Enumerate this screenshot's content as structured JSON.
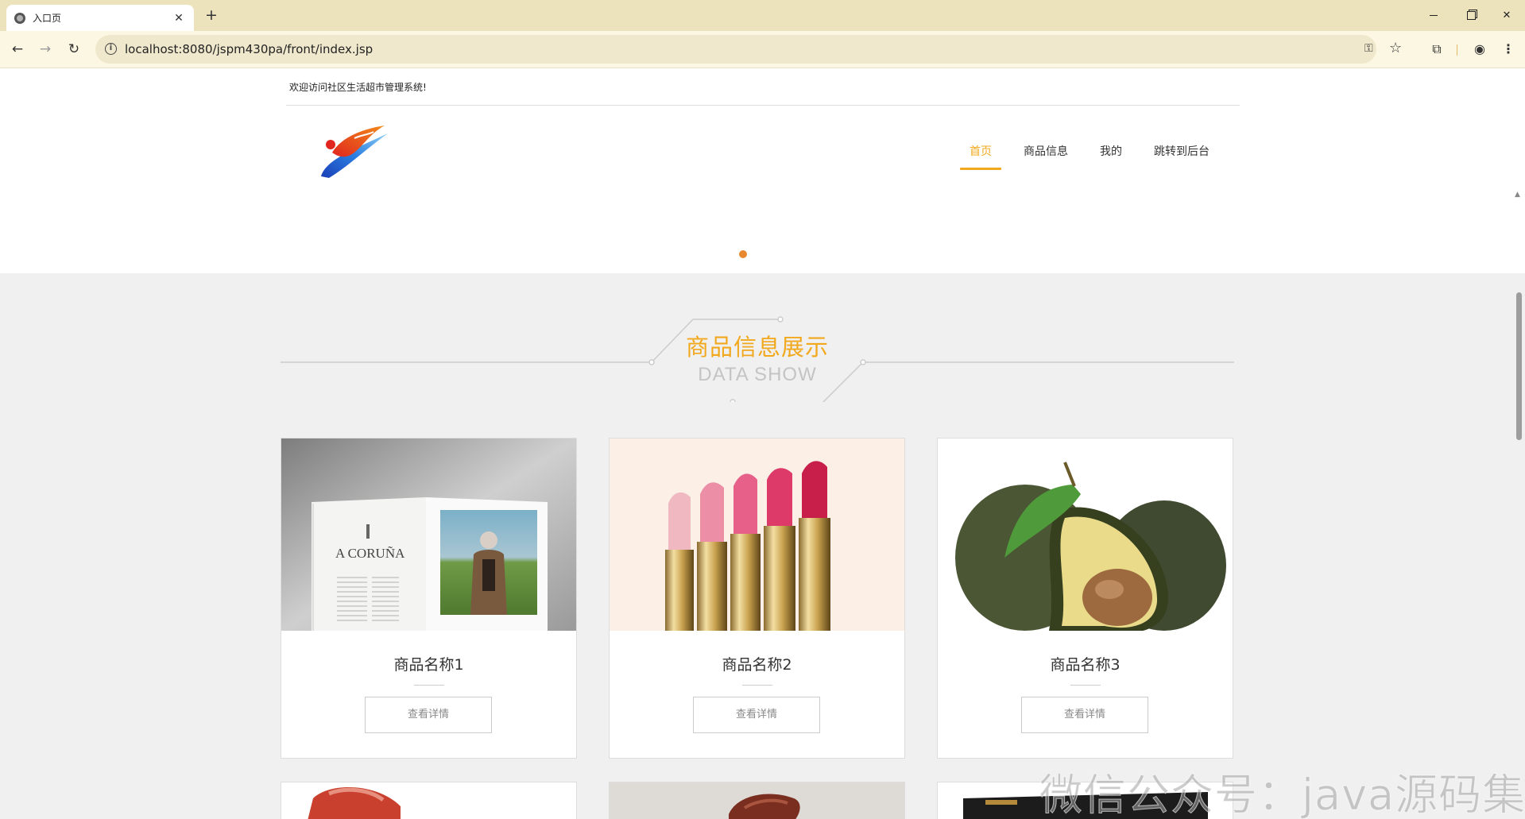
{
  "browser": {
    "tab_title": "入口页",
    "tab_close": "✕",
    "new_tab": "+",
    "url": "localhost:8080/jspm430pa/front/index.jsp",
    "back": "←",
    "forward": "→",
    "reload": "↻",
    "info": "i",
    "key": "⚿",
    "star": "☆",
    "search_tab": "⧉",
    "profile": "◉",
    "menu": "⋮",
    "close": "✕",
    "accent": "#ece3bd"
  },
  "header": {
    "welcome": "欢迎访问社区生活超市管理系统!",
    "nav": [
      {
        "label": "首页",
        "active": true
      },
      {
        "label": "商品信息",
        "active": false
      },
      {
        "label": "我的",
        "active": false
      },
      {
        "label": "跳转到后台",
        "active": false
      }
    ],
    "accent": "#f2a81d"
  },
  "section": {
    "title_cn": "商品信息展示",
    "title_en": "DATA SHOW"
  },
  "products": [
    {
      "name": "商品名称1",
      "button": "查看详情",
      "image": "open-book-photo",
      "image_text": "A CORUÑA"
    },
    {
      "name": "商品名称2",
      "button": "查看详情",
      "image": "lipsticks-photo"
    },
    {
      "name": "商品名称3",
      "button": "查看详情",
      "image": "avocado-photo"
    }
  ],
  "watermark": "微信公众号：java源码集合"
}
